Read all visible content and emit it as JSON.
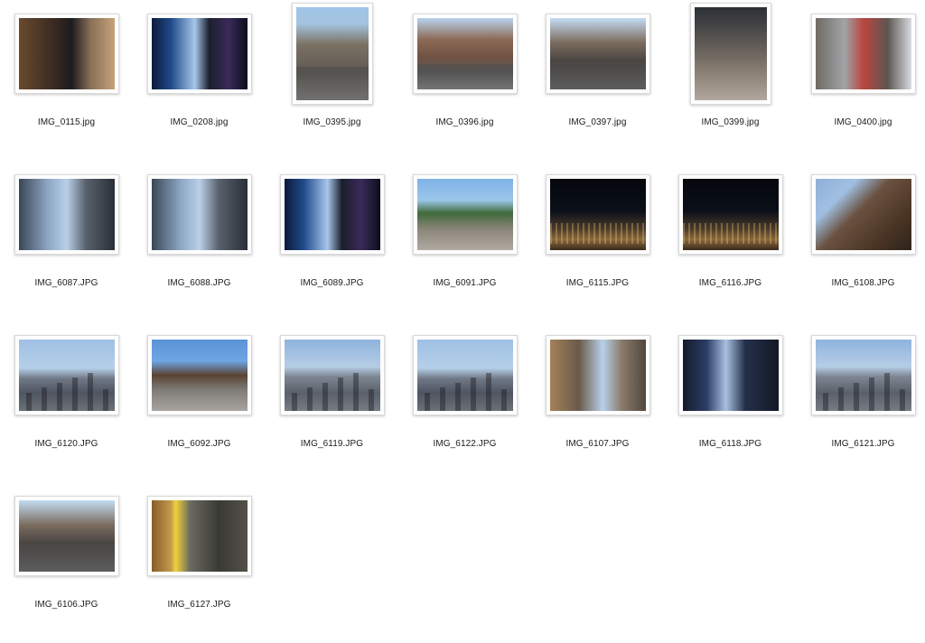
{
  "files": [
    {
      "name": "IMG_0115.jpg",
      "scene": "s-lobby"
    },
    {
      "name": "IMG_0208.jpg",
      "scene": "s-tsq"
    },
    {
      "name": "IMG_0395.jpg",
      "scene": "s-street",
      "portrait": true
    },
    {
      "name": "IMG_0396.jpg",
      "scene": "s-street2"
    },
    {
      "name": "IMG_0397.jpg",
      "scene": "s-avenue"
    },
    {
      "name": "IMG_0399.jpg",
      "scene": "s-dim",
      "portrait": true
    },
    {
      "name": "IMG_0400.jpg",
      "scene": "s-red"
    },
    {
      "name": "IMG_6087.JPG",
      "scene": "s-tall"
    },
    {
      "name": "IMG_6088.JPG",
      "scene": "s-tall"
    },
    {
      "name": "IMG_6089.JPG",
      "scene": "s-tsq"
    },
    {
      "name": "IMG_6091.JPG",
      "scene": "s-market"
    },
    {
      "name": "IMG_6115.JPG",
      "scene": "s-night"
    },
    {
      "name": "IMG_6116.JPG",
      "scene": "s-night"
    },
    {
      "name": "IMG_6108.JPG",
      "scene": "s-brick"
    },
    {
      "name": "IMG_6120.JPG",
      "scene": "s-skyline"
    },
    {
      "name": "IMG_6092.JPG",
      "scene": "s-plaza"
    },
    {
      "name": "IMG_6119.JPG",
      "scene": "s-pano"
    },
    {
      "name": "IMG_6122.JPG",
      "scene": "s-skyline"
    },
    {
      "name": "IMG_6107.JPG",
      "scene": "s-sun"
    },
    {
      "name": "IMG_6118.JPG",
      "scene": "s-dusk"
    },
    {
      "name": "IMG_6121.JPG",
      "scene": "s-pano"
    },
    {
      "name": "IMG_6106.JPG",
      "scene": "s-avenue"
    },
    {
      "name": "IMG_6127.JPG",
      "scene": "s-subway"
    }
  ]
}
